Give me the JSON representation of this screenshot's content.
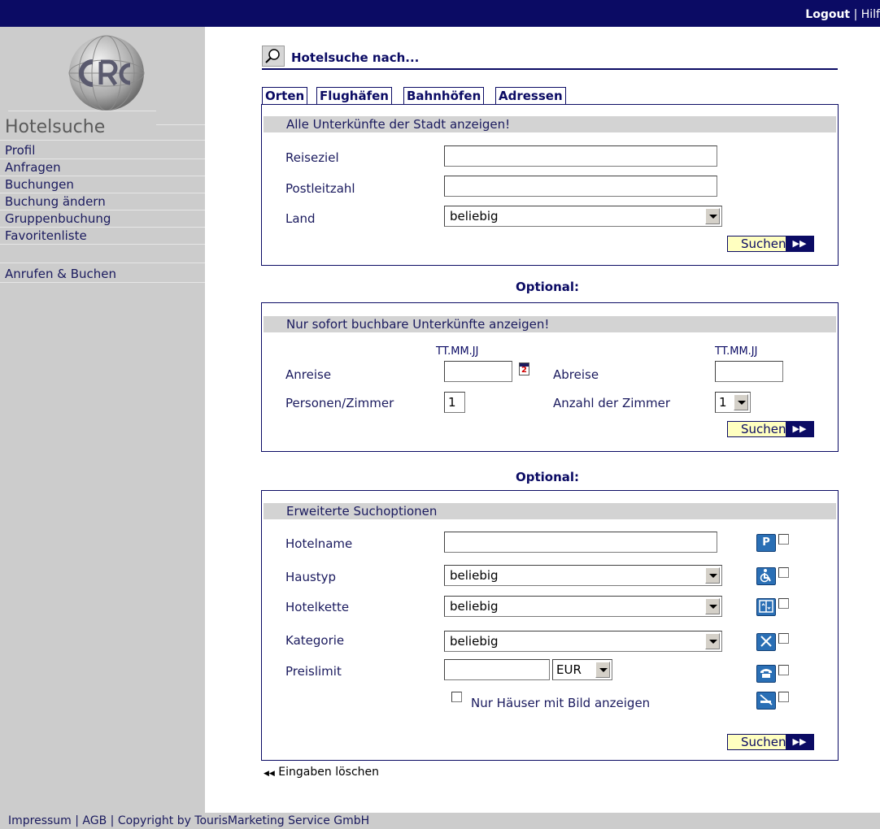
{
  "header": {
    "logout_label": "Logout",
    "separator": "|",
    "help_label": "Hilf"
  },
  "sidebar": {
    "brand": "Hotelsuche",
    "items": [
      {
        "label": "Profil"
      },
      {
        "label": "Anfragen"
      },
      {
        "label": "Buchungen"
      },
      {
        "label": "Buchung ändern"
      },
      {
        "label": "Gruppenbuchung"
      },
      {
        "label": "Favoritenliste"
      },
      {
        "label": "Anrufen & Buchen"
      }
    ]
  },
  "main": {
    "title": "Hotelsuche nach...",
    "tabs": [
      {
        "label": "Orten"
      },
      {
        "label": "Flughäfen"
      },
      {
        "label": "Bahnhöfen"
      },
      {
        "label": "Adressen"
      }
    ],
    "panel1": {
      "heading": "Alle Unterkünfte der Stadt anzeigen!",
      "reiseziel_label": "Reiseziel",
      "reiseziel_value": "",
      "plz_label": "Postleitzahl",
      "plz_value": "",
      "land_label": "Land",
      "land_value": "beliebig",
      "search_label": "Suchen"
    },
    "optional_label": "Optional:",
    "panel2": {
      "heading": "Nur sofort buchbare Unterkünfte anzeigen!",
      "date_format": "TT.MM.JJ",
      "anreise_label": "Anreise",
      "anreise_value": "",
      "calendar_text": "2",
      "abreise_label": "Abreise",
      "abreise_value": "",
      "persons_label": "Personen/Zimmer",
      "persons_value": "1",
      "rooms_label": "Anzahl der Zimmer",
      "rooms_value": "1",
      "search_label": "Suchen"
    },
    "panel3": {
      "heading": "Erweiterte Suchoptionen",
      "hotelname_label": "Hotelname",
      "hotelname_value": "",
      "haustyp_label": "Haustyp",
      "haustyp_value": "beliebig",
      "hotelkette_label": "Hotelkette",
      "hotelkette_value": "beliebig",
      "kategorie_label": "Kategorie",
      "kategorie_value": "beliebig",
      "preislimit_label": "Preislimit",
      "preislimit_value": "",
      "currency_value": "EUR",
      "photo_only_label": "Nur Häuser mit Bild anzeigen",
      "amenity_icons": [
        "parking-icon",
        "wheelchair-icon",
        "elevator-icon",
        "restaurant-icon",
        "telephone-icon",
        "no-smoking-icon"
      ],
      "parking_glyph": "P",
      "search_label": "Suchen"
    },
    "reset_label": "Eingaben löschen"
  },
  "footer": {
    "text": "Impressum | AGB | Copyright by TourisMarketing Service GmbH"
  },
  "colors": {
    "navy": "#0b0b64",
    "sidebar_gray": "#cccccc",
    "button_yellow": "#ffffc0",
    "icon_blue": "#2a6fb5"
  }
}
